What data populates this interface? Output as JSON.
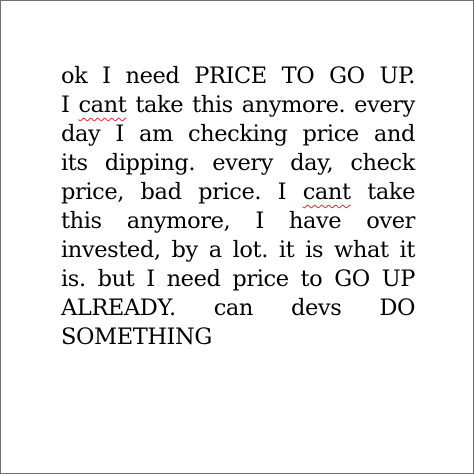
{
  "document": {
    "lines": [
      {
        "parts": [
          {
            "text": "ok I need PRICE TO GO UP."
          }
        ]
      },
      {
        "parts": [
          {
            "text": "I "
          },
          {
            "text": "cant",
            "misspelled": true
          },
          {
            "text": " take this anymore. every"
          }
        ]
      },
      {
        "parts": [
          {
            "text": "day I am checking price and"
          }
        ]
      },
      {
        "parts": [
          {
            "text": "its dipping. every day, check"
          }
        ]
      },
      {
        "parts": [
          {
            "text": "price, bad price. I "
          },
          {
            "text": "cant",
            "misspelled": true
          },
          {
            "text": " take"
          }
        ]
      },
      {
        "parts": [
          {
            "text": "this anymore, I have over"
          }
        ]
      },
      {
        "parts": [
          {
            "text": "invested, by a lot. it is what it"
          }
        ]
      },
      {
        "parts": [
          {
            "text": "is. but I need price to GO UP"
          }
        ]
      },
      {
        "parts": [
          {
            "text": "ALREADY. can devs DO"
          }
        ]
      },
      {
        "parts": [
          {
            "text": "SOMETHING"
          }
        ]
      }
    ]
  },
  "colors": {
    "text": "#000000",
    "background": "#ffffff",
    "border": "#6f6f6f",
    "spellcheck_underline": "#e8262e"
  }
}
